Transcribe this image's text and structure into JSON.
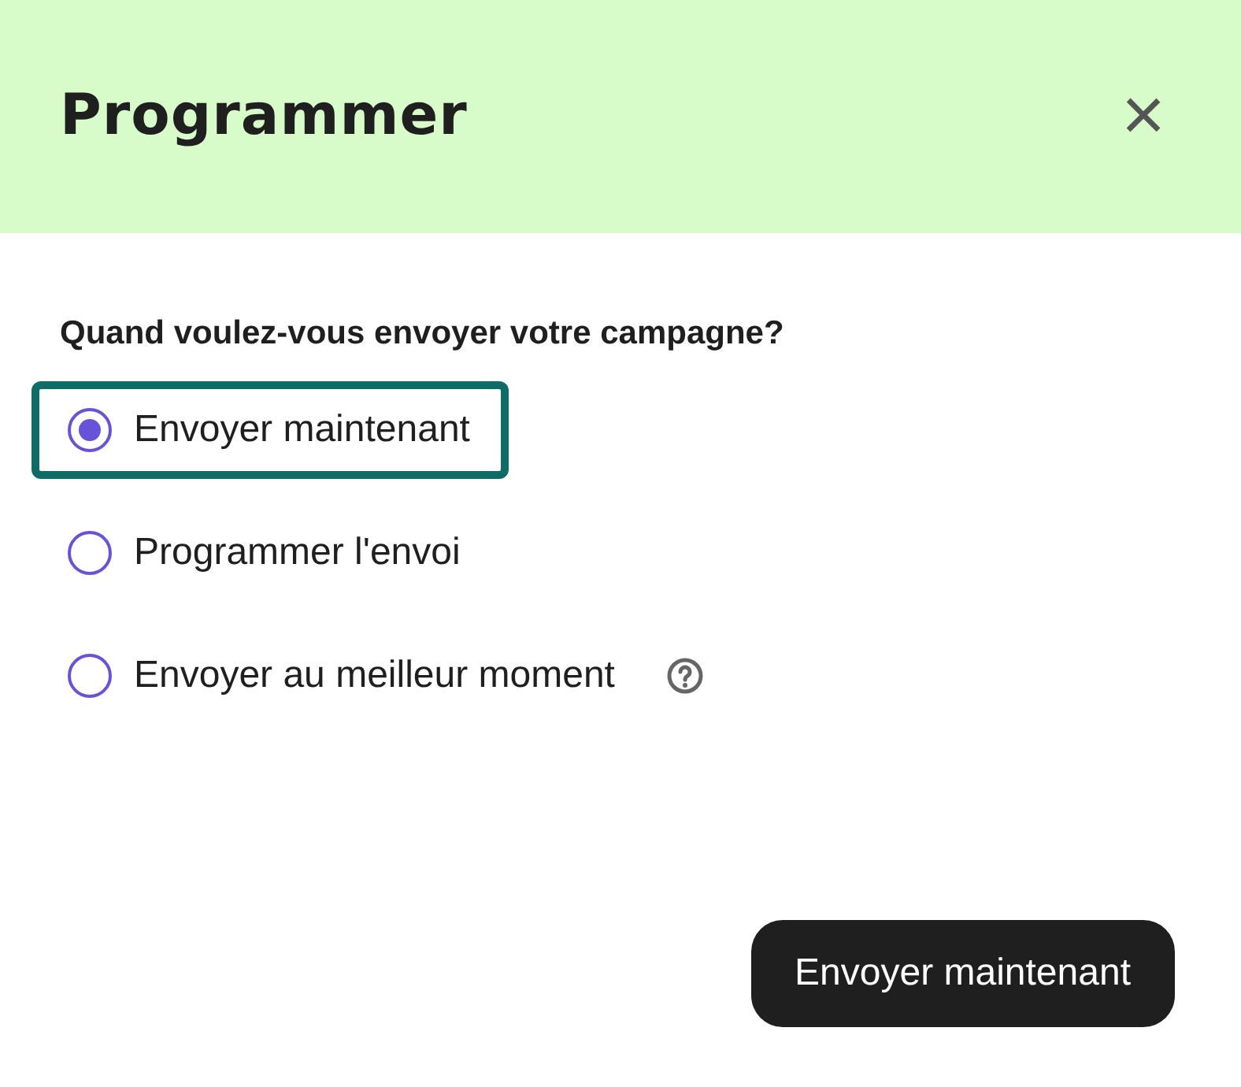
{
  "dialog": {
    "title": "Programmer",
    "close": "×"
  },
  "question": "Quand voulez-vous envoyer votre campagne?",
  "options": [
    {
      "label": "Envoyer maintenant",
      "selected": true,
      "focused": true,
      "help": false
    },
    {
      "label": "Programmer l'envoi",
      "selected": false,
      "focused": false,
      "help": false
    },
    {
      "label": "Envoyer au meilleur moment",
      "selected": false,
      "focused": false,
      "help": true
    }
  ],
  "buttons": [
    {
      "label": "Envoyer maintenant"
    }
  ]
}
